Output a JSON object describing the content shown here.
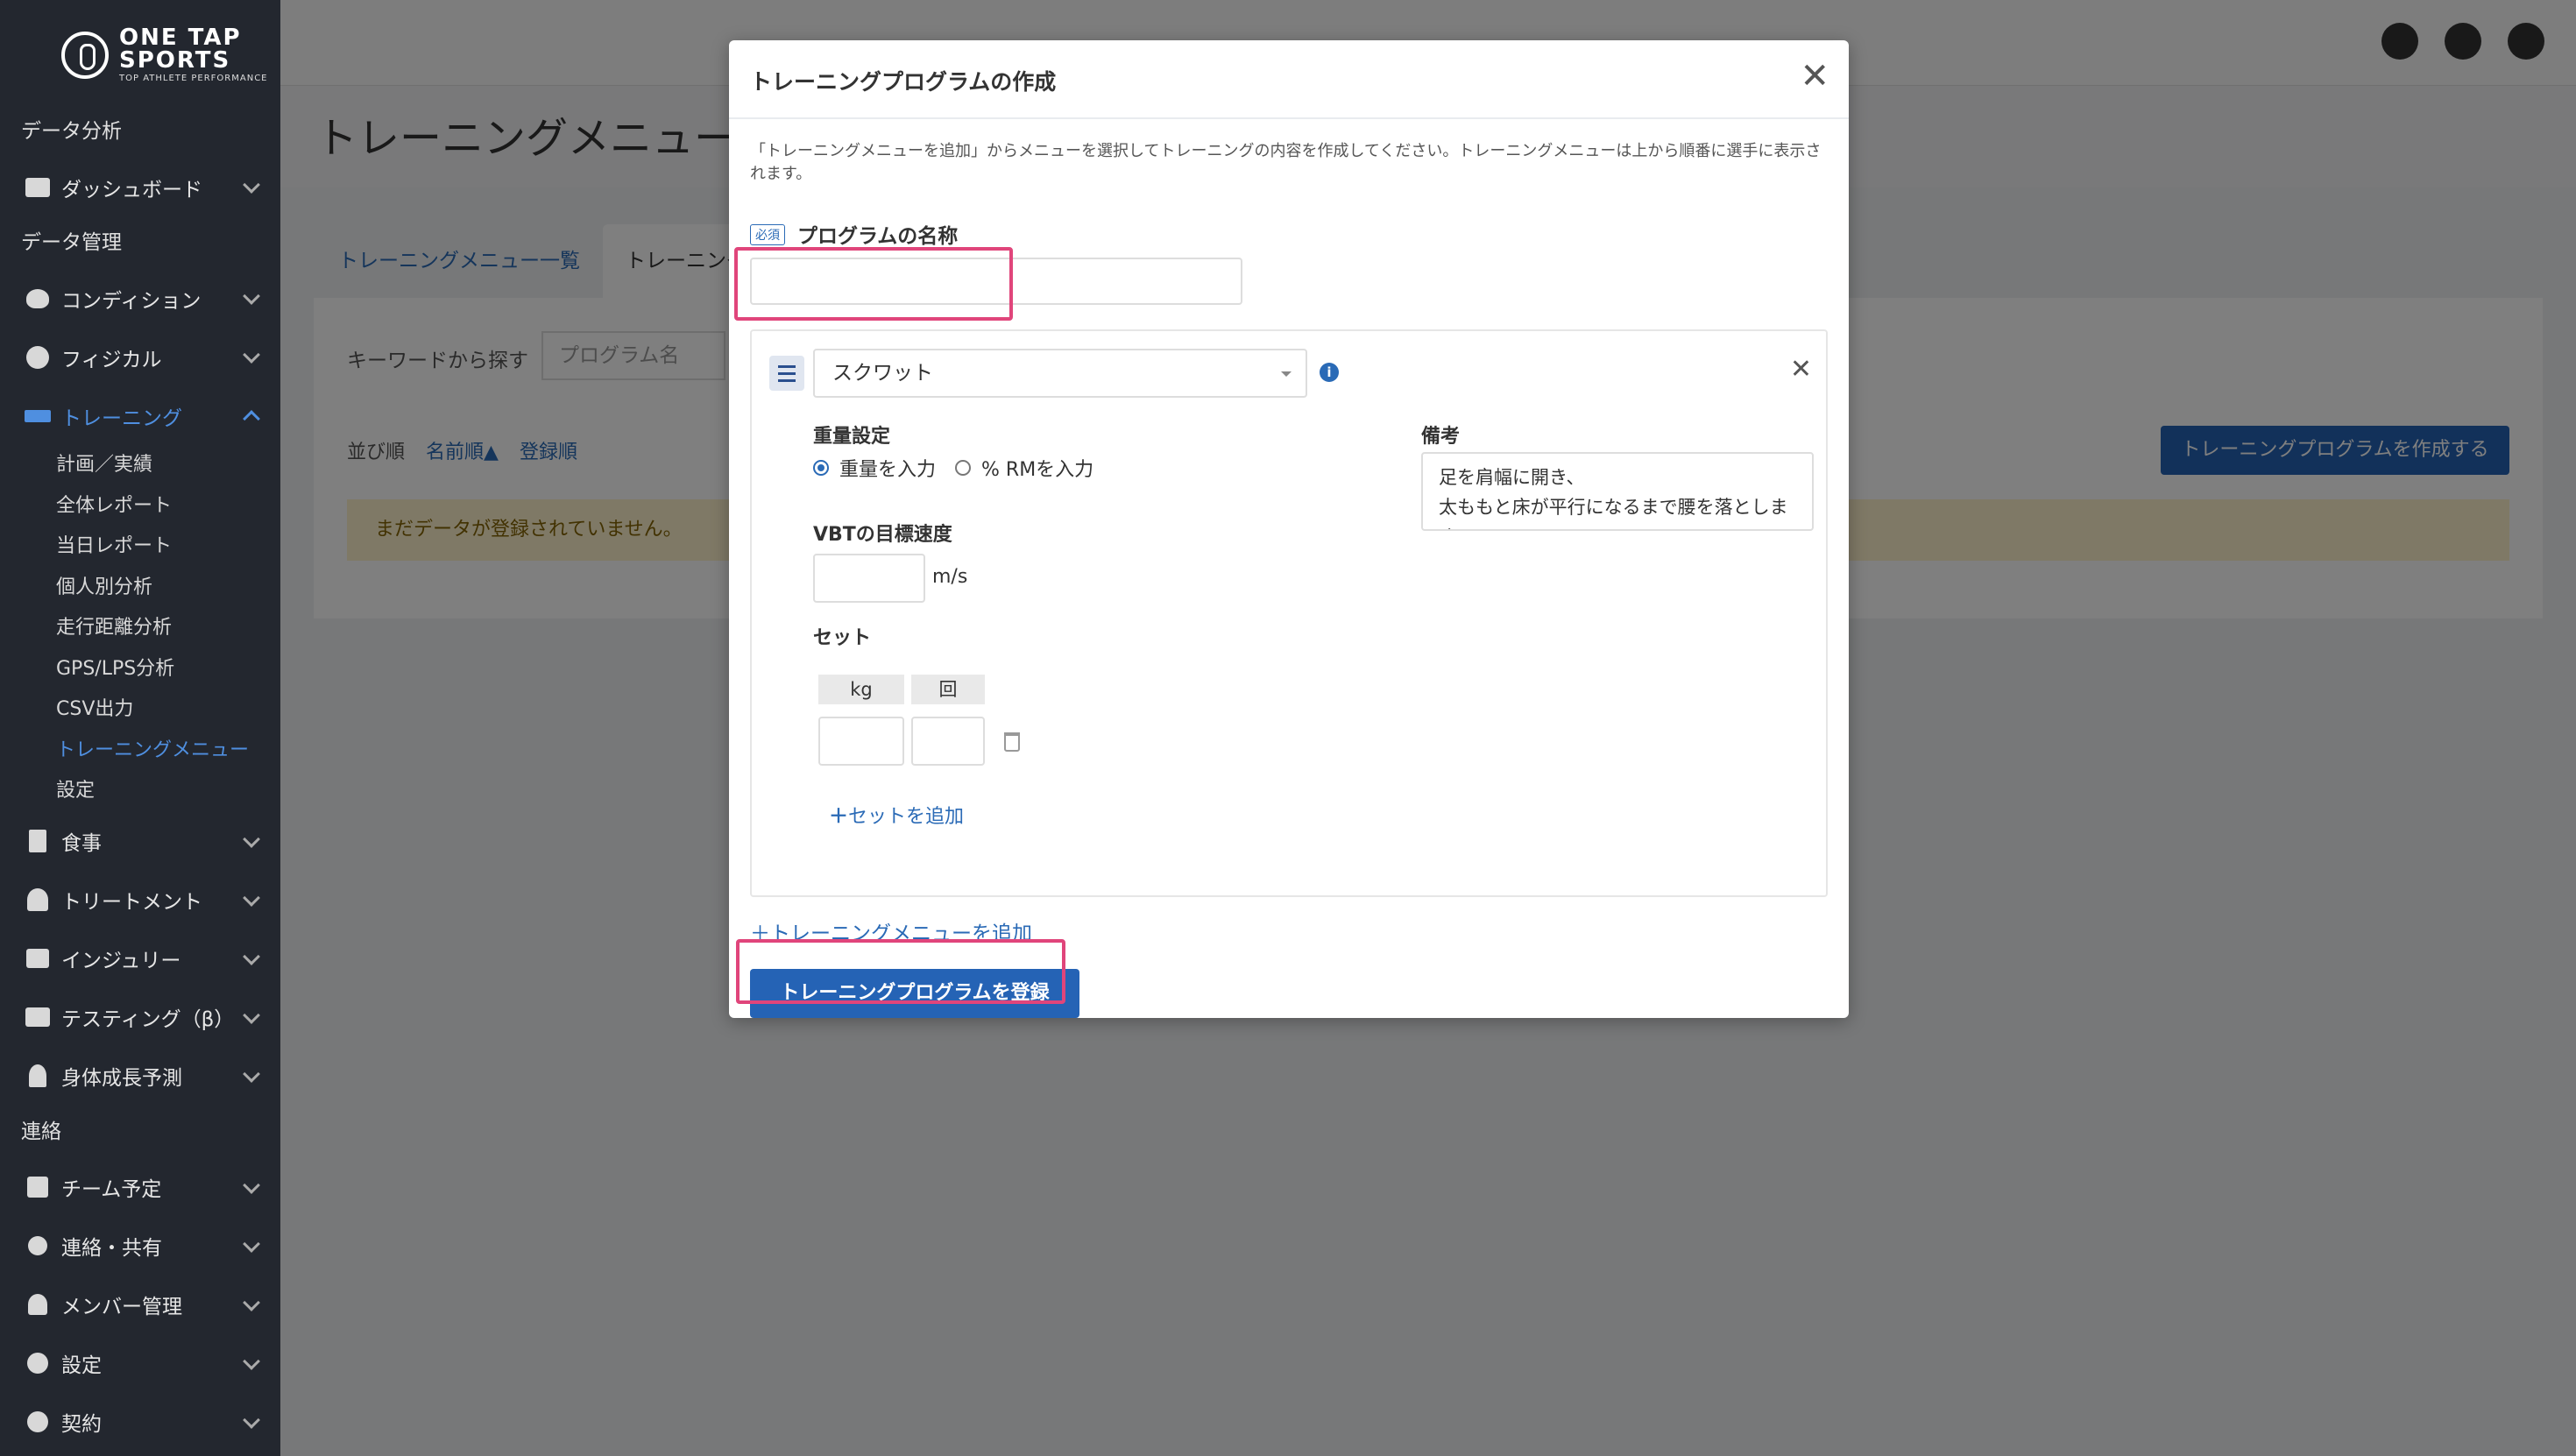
{
  "logo": {
    "line1": "ONE TAP",
    "line2": "SPORTS",
    "tagline": "TOP ATHLETE PERFORMANCE"
  },
  "sidebar": {
    "section_analysis": "データ分析",
    "dashboard": "ダッシュボード",
    "section_data": "データ管理",
    "condition": "コンディション",
    "physical": "フィジカル",
    "training": "トレーニング",
    "training_sub": [
      "計画／実績",
      "全体レポート",
      "当日レポート",
      "個人別分析",
      "走行距離分析",
      "GPS/LPS分析",
      "CSV出力",
      "トレーニングメニュー",
      "設定"
    ],
    "meal": "食事",
    "treatment": "トリートメント",
    "injury": "インジュリー",
    "testing": "テスティング（β）",
    "growth": "身体成長予測",
    "section_contact": "連絡",
    "team_schedule": "チーム予定",
    "contact_share": "連絡・共有",
    "member_mgmt": "メンバー管理",
    "settings": "設定",
    "contract": "契約"
  },
  "page": {
    "title": "トレーニングメニュー",
    "tab_list": "トレーニングメニュー一覧",
    "tab_program": "トレーニング",
    "search_label": "キーワードから探す",
    "search_placeholder": "プログラム名",
    "sort_label": "並び順",
    "sort_name": "名前順▲",
    "sort_reg": "登録順",
    "create_button": "トレーニングプログラムを作成する",
    "empty_alert": "まだデータが登録されていません。"
  },
  "modal": {
    "title": "トレーニングプログラムの作成",
    "close": "✕",
    "description": "「トレーニングメニューを追加」からメニューを選択してトレーニングの内容を作成してください。トレーニングメニューは上から順番に選手に表示されます。",
    "required_badge": "必須",
    "name_label": "プログラムの名称",
    "name_value": "",
    "menu": {
      "selected": "スクワット",
      "weight_setting_label": "重量設定",
      "radio_weight": "重量を入力",
      "radio_rm": "% RMを入力",
      "vbt_label": "VBTの目標速度",
      "vbt_unit": "m/s",
      "set_label": "セット",
      "col_kg": "kg",
      "col_reps": "回",
      "add_set": "セットを追加",
      "notes_label": "備考",
      "notes_value": "足を肩幅に開き、\n太ももと床が平行になるまで腰を落とします。"
    },
    "add_menu": "トレーニングメニューを追加",
    "submit": "トレーニングプログラムを登録"
  },
  "colors": {
    "accent": "#2563b5",
    "highlight": "#e0457b",
    "sidebar": "#23272f"
  }
}
